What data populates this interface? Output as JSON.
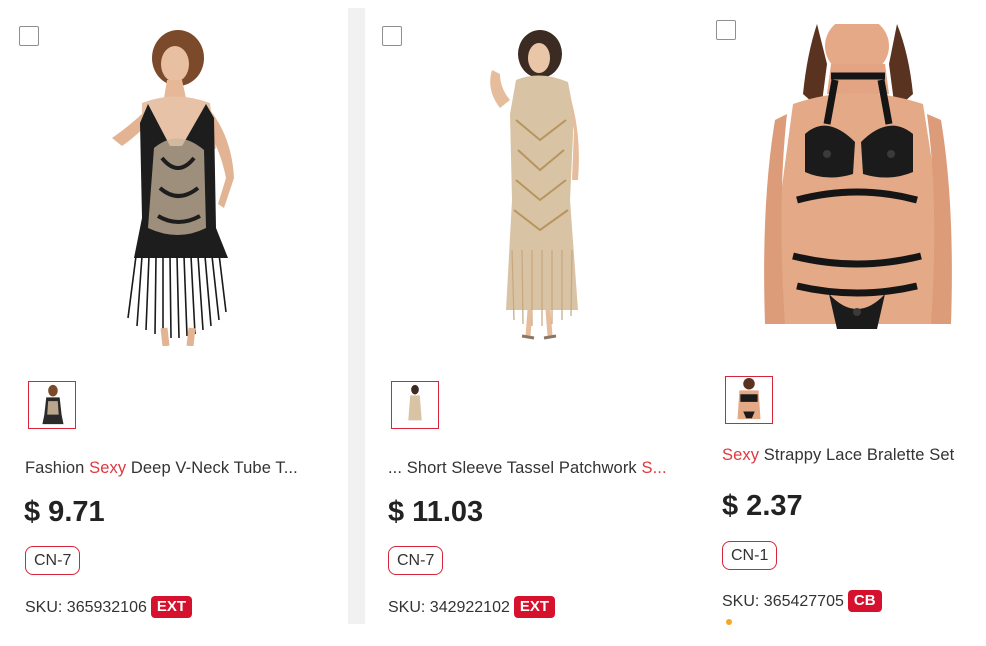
{
  "products": [
    {
      "title_prefix": "Fashion ",
      "title_highlight": "Sexy",
      "title_suffix": " Deep V-Neck Tube T...",
      "price": "$ 9.71",
      "warehouse": "CN-7",
      "sku_label": "SKU: 365932106",
      "sku_tag": "EXT",
      "image": "black-sequin-fringe-dress-image"
    },
    {
      "title_prefix": "... Short Sleeve Tassel Patchwork ",
      "title_highlight": "S...",
      "title_suffix": "",
      "price": "$ 11.03",
      "warehouse": "CN-7",
      "sku_label": "SKU: 342922102",
      "sku_tag": "EXT",
      "image": "gold-sequin-tassel-dress-image"
    },
    {
      "title_prefix": "",
      "title_highlight": "Sexy",
      "title_suffix": " Strappy Lace Bralette Set",
      "price": "$ 2.37",
      "warehouse": "CN-1",
      "sku_label": "SKU: 365427705",
      "sku_tag": "CB",
      "image": "black-strappy-lace-bralette-set-image"
    }
  ],
  "colors": {
    "accent": "#d6243a",
    "highlight_text": "#e0383e",
    "tag_background": "#d6112e",
    "divider": "#f1f1f1"
  }
}
